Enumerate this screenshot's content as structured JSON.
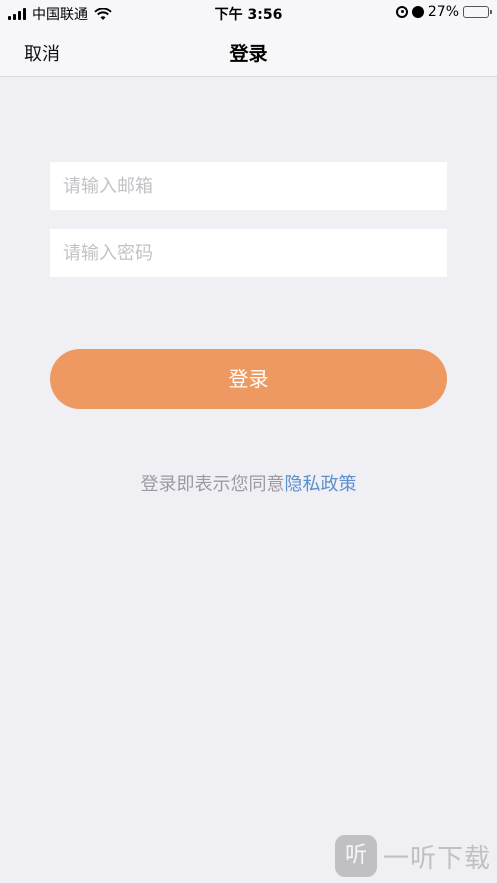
{
  "status_bar": {
    "carrier": "中国联通",
    "time": "下午 3:56",
    "battery": "27%",
    "battery_level": 0.27,
    "icons": [
      "signal-icon",
      "wifi-icon",
      "orientation-lock-icon",
      "alarm-icon",
      "battery-icon"
    ]
  },
  "nav": {
    "cancel": "取消",
    "title": "登录"
  },
  "form": {
    "email_placeholder": "请输入邮箱",
    "email_value": "",
    "password_placeholder": "请输入密码",
    "password_value": "",
    "login_button": "登录"
  },
  "agreement": {
    "prefix": "登录即表示您同意",
    "link": "隐私政策"
  },
  "watermark": {
    "logo": "听",
    "text": "一听下载"
  },
  "colors": {
    "background": "#efeff4",
    "accent": "#ee9961",
    "link": "#5b8fce"
  }
}
